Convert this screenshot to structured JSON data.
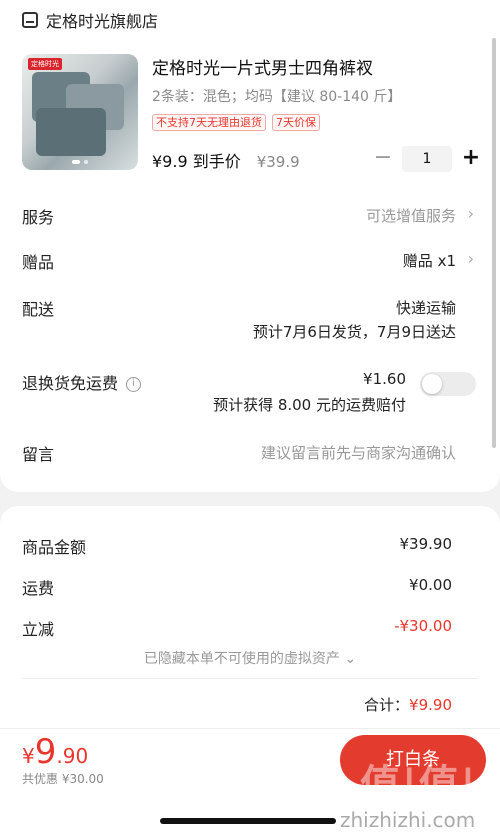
{
  "store": {
    "name": "定格时光旗舰店",
    "icon": "store-icon"
  },
  "product": {
    "brand_tag": "定格时光",
    "title": "定格时光一片式男士四角裤衩",
    "spec": "2条装：混色；均码【建议 80-140 斤】",
    "tags": [
      "不支持7天无理由退货",
      "7天价保"
    ],
    "price_now": "¥9.9 到手价",
    "price_old": "¥39.9",
    "quantity": "1",
    "minus": "−",
    "plus": "+"
  },
  "rows": {
    "service_label": "服务",
    "service_value": "可选增值服务",
    "gift_label": "赠品",
    "gift_value": "赠品 x1",
    "delivery_label": "配送",
    "delivery_method": "快递运输",
    "delivery_time": "预计7月6日发货，7月9日送达",
    "return_label": "退换货免运费",
    "return_price": "¥1.60",
    "return_desc": "预计获得 8.00 元的运费赔付",
    "message_label": "留言",
    "message_placeholder": "建议留言前先与商家沟通确认"
  },
  "summary": {
    "goods_label": "商品金额",
    "goods_value": "¥39.90",
    "shipping_label": "运费",
    "shipping_value": "¥0.00",
    "discount_label": "立减",
    "discount_value": "-¥30.00",
    "hidden_assets": "已隐藏本单不可使用的虚拟资产 ⌄",
    "total_label": "合计：",
    "total_value": "¥9.90"
  },
  "pay": {
    "yen": "¥",
    "int": "9",
    "dec": ".90",
    "saved": "共优惠 ¥30.00",
    "button": "打白条"
  },
  "watermark": {
    "text": "值|值|值",
    "url": "zhizhizhi.com"
  },
  "colors": {
    "accent": "#e8362d",
    "button": "#e33b2e"
  }
}
